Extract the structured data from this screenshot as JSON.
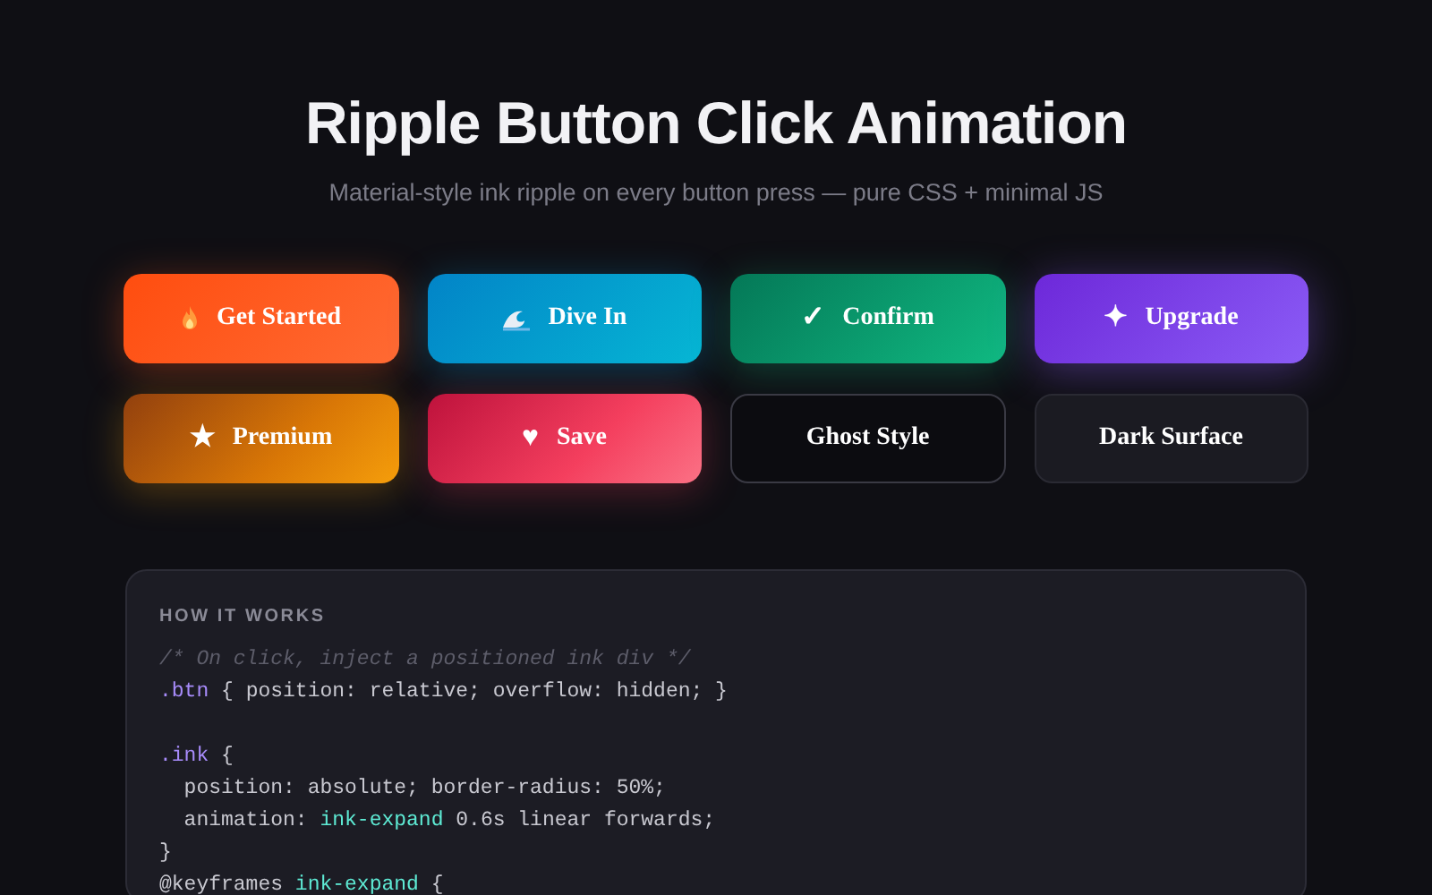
{
  "header": {
    "title": "Ripple Button Click Animation",
    "subtitle": "Material-style ink ripple on every button press — pure CSS + minimal JS"
  },
  "buttons": [
    {
      "label": "Get Started"
    },
    {
      "label": "Dive In"
    },
    {
      "label": "Confirm",
      "glyph": "✓"
    },
    {
      "label": "Upgrade",
      "glyph": "✦"
    },
    {
      "label": "Premium",
      "glyph": "★"
    },
    {
      "label": "Save",
      "glyph": "♥"
    },
    {
      "label": "Ghost Style"
    },
    {
      "label": "Dark Surface"
    }
  ],
  "code_panel": {
    "heading": "HOW IT WORKS",
    "blocks": [
      [
        [
          {
            "kind": "comment",
            "text": "/* On click, inject a positioned ink div */"
          }
        ],
        [
          {
            "kind": "selector",
            "text": ".btn"
          },
          {
            "kind": "plain",
            "text": " { position: relative; overflow: hidden; }"
          }
        ]
      ],
      [
        [
          {
            "kind": "selector",
            "text": ".ink"
          },
          {
            "kind": "plain",
            "text": " {"
          }
        ],
        [
          {
            "kind": "plain",
            "text": "  position: absolute; border-radius: 50%;"
          }
        ],
        [
          {
            "kind": "plain",
            "text": "  animation: "
          },
          {
            "kind": "name",
            "text": "ink-expand"
          },
          {
            "kind": "plain",
            "text": " 0.6s linear forwards;"
          }
        ],
        [
          {
            "kind": "plain",
            "text": "}"
          }
        ],
        [
          {
            "kind": "plain",
            "text": "@keyframes "
          },
          {
            "kind": "name",
            "text": "ink-expand"
          },
          {
            "kind": "plain",
            "text": " {"
          }
        ]
      ]
    ]
  }
}
